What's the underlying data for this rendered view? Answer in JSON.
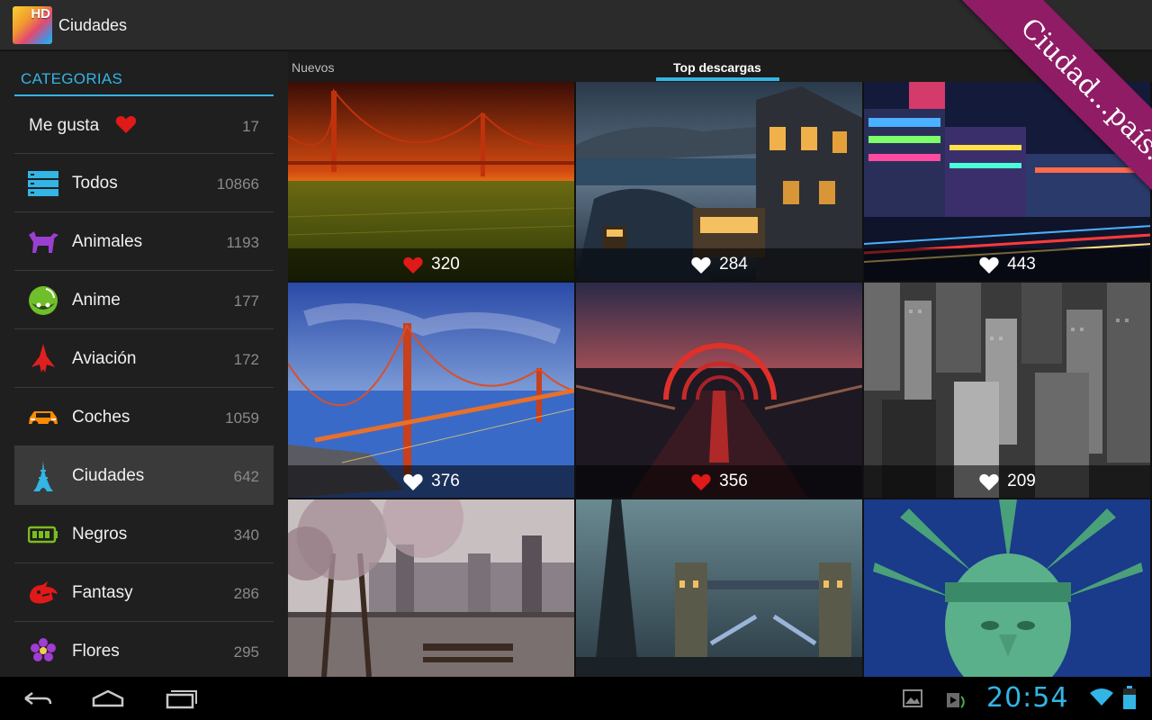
{
  "app": {
    "title": "Ciudades",
    "icon_label": "HD"
  },
  "sidebar": {
    "header": "CATEGORIAS",
    "items": [
      {
        "label": "Me gusta",
        "count": "17",
        "icon": "heart-icon"
      },
      {
        "label": "Todos",
        "count": "10866",
        "icon": "list-icon"
      },
      {
        "label": "Animales",
        "count": "1193",
        "icon": "dog-icon"
      },
      {
        "label": "Anime",
        "count": "177",
        "icon": "anime-face-icon"
      },
      {
        "label": "Aviación",
        "count": "172",
        "icon": "jet-icon"
      },
      {
        "label": "Coches",
        "count": "1059",
        "icon": "car-icon"
      },
      {
        "label": "Ciudades",
        "count": "642",
        "icon": "eiffel-tower-icon",
        "selected": true
      },
      {
        "label": "Negros",
        "count": "340",
        "icon": "battery-icon"
      },
      {
        "label": "Fantasy",
        "count": "286",
        "icon": "dragon-icon"
      },
      {
        "label": "Flores",
        "count": "295",
        "icon": "flower-icon"
      }
    ]
  },
  "tabs": {
    "items": [
      "Nuevos",
      "Top descargas"
    ],
    "selected": "Top descargas"
  },
  "ribbon": {
    "text": "Ciudad...país..."
  },
  "grid": {
    "tiles": [
      {
        "likes": "320",
        "liked": true,
        "scene": "golden-gate-sunset"
      },
      {
        "likes": "284",
        "liked": false,
        "scene": "san-francisco-night-tram"
      },
      {
        "likes": "443",
        "liked": false,
        "scene": "bangkok-central-world-night"
      },
      {
        "likes": "376",
        "liked": false,
        "scene": "golden-gate-blue-hour"
      },
      {
        "likes": "356",
        "liked": true,
        "scene": "falkirk-arches-dusk"
      },
      {
        "likes": "209",
        "liked": false,
        "scene": "new-york-aerial-bw"
      },
      {
        "likes": "",
        "liked": false,
        "scene": "park-cherry-blossom-skyline"
      },
      {
        "likes": "",
        "liked": false,
        "scene": "tower-bridge-london-night"
      },
      {
        "likes": "",
        "liked": false,
        "scene": "statue-of-liberty"
      }
    ]
  },
  "statusbar": {
    "time": "20:54"
  },
  "colors": {
    "accent": "#33b5e5",
    "ribbon": "#8f1c65",
    "liked_heart": "#e01919"
  }
}
